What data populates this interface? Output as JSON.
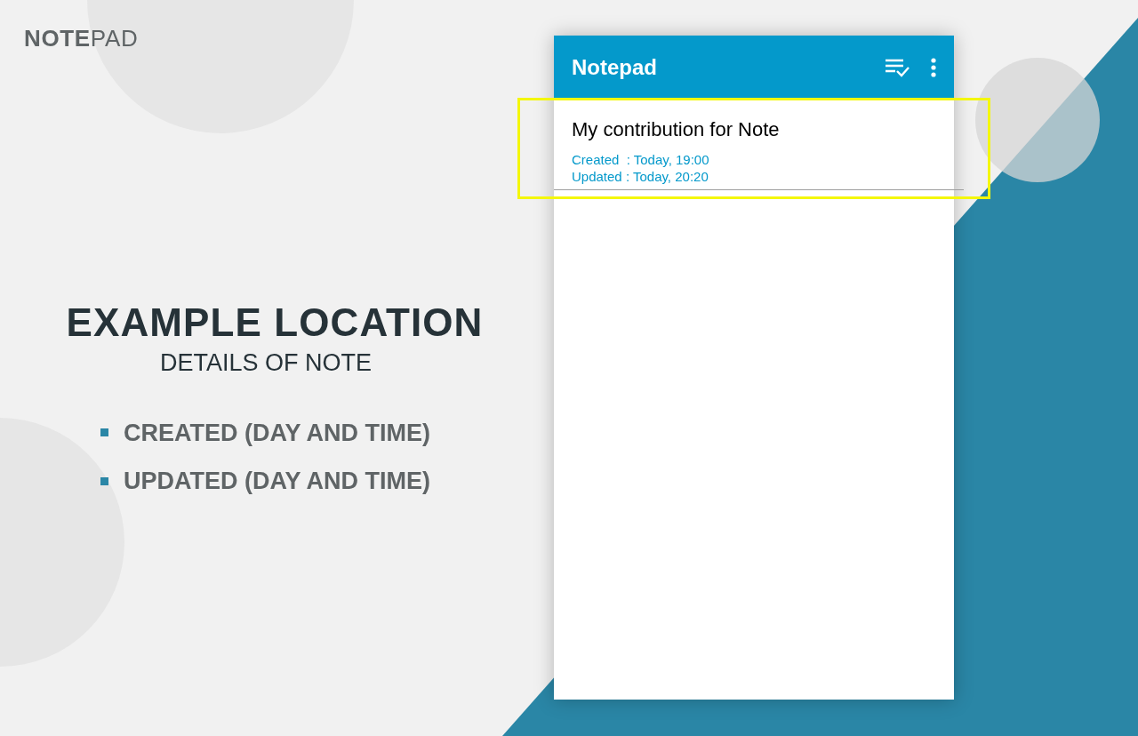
{
  "brand": "**NOTE**PAD",
  "heading": "EXAMPLE LOCATION",
  "subheading": "DETAILS OF NOTE",
  "bullets": [
    "CREATED (DAY AND TIME)",
    "UPDATED (DAY AND TIME)"
  ],
  "app": {
    "title": "Notepad",
    "notes": [
      {
        "title": "My contribution for Note",
        "created": "Created  : Today, 19:00",
        "updated": "Updated : Today, 20:20",
        "highlighted": true
      }
    ]
  }
}
